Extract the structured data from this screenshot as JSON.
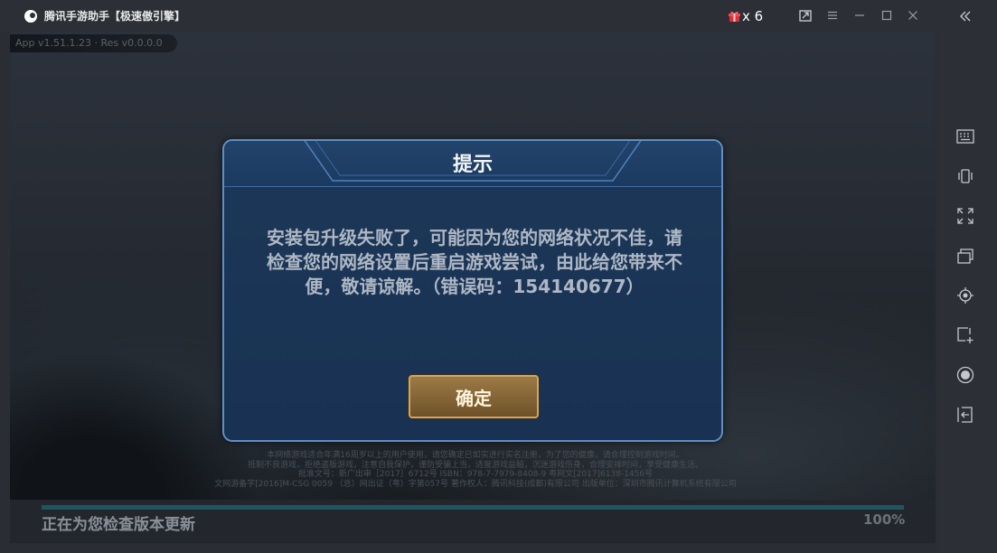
{
  "titlebar": {
    "title": "腾讯手游助手【极速傲引擎】",
    "gift_count": "x 6"
  },
  "game": {
    "version": "App v1.51.1.23 · Res v0.0.0.0",
    "dialog": {
      "title": "提示",
      "message": "安装包升级失败了，可能因为您的网络状况不佳，请检查您的网络设置后重启游戏尝试，由此给您带来不便，敬请谅解。（错误码：154140677）",
      "ok_label": "确定"
    },
    "notice": [
      "本网络游戏适合年满16周岁以上的用户使用，请您确定已如实进行实名注册，为了您的健康，请合理控制游戏时间。",
      "抵制不良游戏，拒绝盗版游戏，注意自我保护，谨防受骗上当，适度游戏益脑，沉迷游戏伤身，合理安排时间，享受健康生活。",
      "批准文号：新广出审［2017］6712号 ISBN：978-7-7979-8408-9 粤网文[2017]6138-1456号",
      "文网游备字[2016]M-CSG 0059 （总）网出证（粤）字第057号 著作权人：腾讯科技(成都)有限公司 出版单位：深圳市腾讯计算机系统有限公司"
    ],
    "status_text": "正在为您检查版本更新",
    "progress_percent": "100%",
    "progress_value": 1.0
  },
  "icons": {
    "titlebar": [
      "app-logo-icon",
      "gift-icon",
      "mini-window-icon",
      "menu-icon",
      "minimize-icon",
      "maximize-icon",
      "close-icon"
    ],
    "sidebar": [
      "collapse-icon",
      "keyboard-icon",
      "shake-icon",
      "fullscreen-icon",
      "multi-window-icon",
      "locate-icon",
      "screenshot-icon",
      "record-icon",
      "exit-icon"
    ]
  },
  "colors": {
    "accent_blue": "#5f8fc4",
    "button_gold": "#c9a86a",
    "gift_red": "#e0303a"
  }
}
